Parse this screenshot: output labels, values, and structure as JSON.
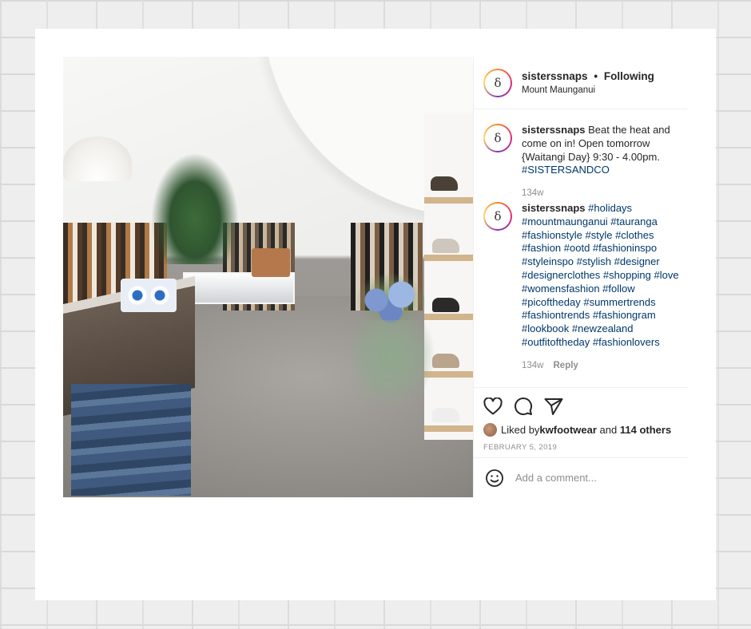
{
  "post": {
    "image_alt": "store interior",
    "header": {
      "username": "sisterssnaps",
      "separator": "•",
      "follow_status": "Following",
      "location": "Mount Maunganui",
      "avatar_glyph": "δ"
    },
    "comments": [
      {
        "username": "sisterssnaps",
        "text": " Beat the heat and come on in! Open tomorrow {Waitangi Day} 9:30 - 4.00pm. ",
        "tags": "#SISTERSANDCO",
        "time": "134w",
        "reply": ""
      },
      {
        "username": "sisterssnaps",
        "text": " ",
        "tags": "#holidays #mountmaunganui #tauranga #fashionstyle #style #clothes #fashion #ootd #fashioninspo #styleinspo #stylish #designer #designerclothes #shopping #love #womensfashion #follow #picoftheday #summertrends #fashiontrends #fashiongram #lookbook #newzealand #outfitoftheday #fashionlovers",
        "time": "134w",
        "reply": "Reply"
      }
    ],
    "actions": {
      "liked_prefix": "Liked by ",
      "liked_user": "kwfootwear",
      "liked_mid": " and ",
      "liked_others": "114 others",
      "date": "FEBRUARY 5, 2019"
    },
    "add_comment": {
      "placeholder": "Add a comment..."
    }
  },
  "colors": {
    "link": "#00376b",
    "text": "#262626",
    "muted": "#8e8e8e",
    "border": "#efefef"
  },
  "icons": [
    "heart-icon",
    "comment-icon",
    "share-icon",
    "emoji-icon"
  ]
}
